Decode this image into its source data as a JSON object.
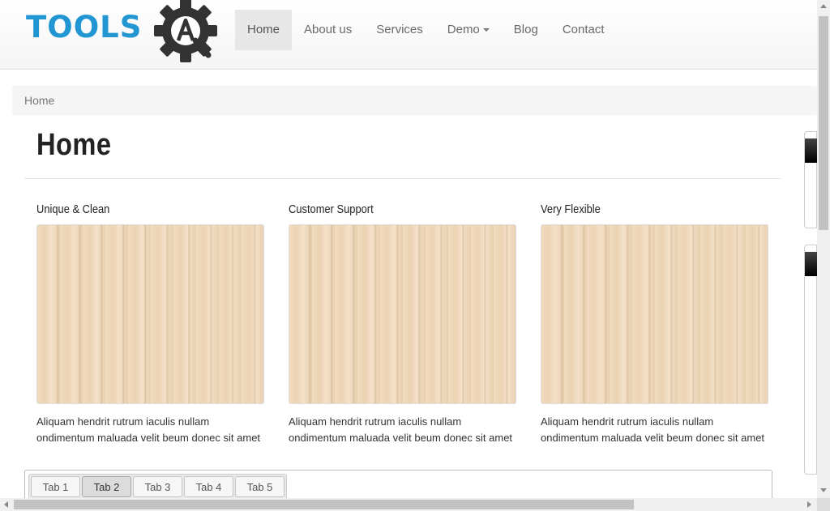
{
  "logo": {
    "text": "TOOLS",
    "gear_letter": "A",
    "text_color": "#2196d3",
    "gear_color": "#333333"
  },
  "nav": {
    "items": [
      {
        "label": "Home",
        "active": true
      },
      {
        "label": "About us"
      },
      {
        "label": "Services"
      },
      {
        "label": "Demo",
        "dropdown": true
      },
      {
        "label": "Blog"
      },
      {
        "label": "Contact"
      }
    ]
  },
  "breadcrumb": {
    "current": "Home"
  },
  "page": {
    "title": "Home"
  },
  "features": [
    {
      "heading": "Unique & Clean",
      "text": "Aliquam hendrit rutrum iaculis nullam ondimentum maluada velit beum donec sit amet"
    },
    {
      "heading": "Customer Support",
      "text": "Aliquam hendrit rutrum iaculis nullam ondimentum maluada velit beum donec sit amet"
    },
    {
      "heading": "Very Flexible",
      "text": "Aliquam hendrit rutrum iaculis nullam ondimentum maluada velit beum donec sit amet"
    }
  ],
  "tabs": [
    {
      "label": "Tab 1"
    },
    {
      "label": "Tab 2",
      "active": true
    },
    {
      "label": "Tab 3"
    },
    {
      "label": "Tab 4"
    },
    {
      "label": "Tab 5"
    }
  ]
}
